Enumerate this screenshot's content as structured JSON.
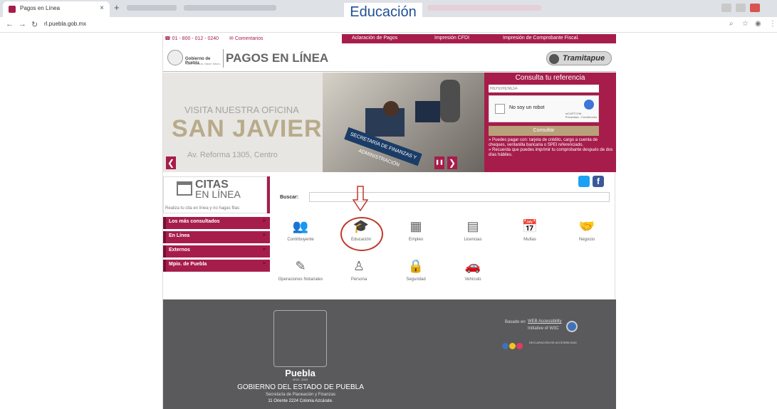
{
  "browser": {
    "tab_title": "Pagos en Línea",
    "tab_close": "×",
    "new_tab": "+",
    "url": "rl.puebla.gob.mx"
  },
  "overlay_title": "Educación",
  "site": {
    "topbar": {
      "phone": "01 - 800 - 012 - 0240",
      "comments": "Comentarios",
      "nav": [
        "Aclaración de Pagos",
        "Impresión CFDI",
        "Impresión de Comprobante Fiscal."
      ]
    },
    "logo_text": "Gobierno de Puebla",
    "logo_subtext": "Hacer historia. Hacer futuro.",
    "page_title": "PAGOS EN LÍNEA",
    "tramitapue": "Tramitapue",
    "banner": {
      "line1": "VISITA NUESTRA OFICINA",
      "line2": "SAN JAVIER",
      "line3": "Av. Reforma 1305, Centro",
      "sign": "SECRETARÍA DE FINANZAS Y ADMINISTRACIÓN",
      "prev": "❮",
      "pause": "❚❚",
      "next": "❯"
    },
    "consulta": {
      "title": "Consulta tu referencia",
      "placeholder": "REFERENCIA",
      "captcha_label": "No soy un robot",
      "captcha_brand": "reCAPTCHA",
      "captcha_terms": "Privacidad - Condiciones",
      "button": "Consultar",
      "info1": "» Puedes pagar con: tarjeta de crédito, cargo a cuenta de cheques, ventanilla bancaria o SPEI referenciado.",
      "info2": "» Recuerda que puedes imprimir tu comprobante después de dos días hábiles."
    },
    "citas": {
      "title1": "CITAS",
      "title2": "EN LÍNEA",
      "sub": "Realiza tu cita en línea y no hagas filas"
    },
    "menu": [
      {
        "label": "Los más consultados",
        "arrow": "►"
      },
      {
        "label": "En Línea",
        "arrow": "►"
      },
      {
        "label": "Externos",
        "arrow": "►"
      },
      {
        "label": "Mpio. de Puebla",
        "arrow": "►"
      }
    ],
    "search_label": "Buscar:",
    "categories": [
      {
        "label": "Contribuyente",
        "icon": "users-icon",
        "glyph": "👥"
      },
      {
        "label": "Educación",
        "icon": "graduation-cap-icon",
        "glyph": "🎓"
      },
      {
        "label": "Empleo",
        "icon": "building-icon",
        "glyph": "▦"
      },
      {
        "label": "Licencias",
        "icon": "id-card-icon",
        "glyph": "▤"
      },
      {
        "label": "Multas",
        "icon": "calendar-check-icon",
        "glyph": "📅"
      },
      {
        "label": "Negocio",
        "icon": "handshake-icon",
        "glyph": "🤝"
      },
      {
        "label": "Operaciones Notariales",
        "icon": "edit-icon",
        "glyph": "✎"
      },
      {
        "label": "Persona",
        "icon": "person-icon",
        "glyph": "♙"
      },
      {
        "label": "Seguridad",
        "icon": "lock-icon",
        "glyph": "🔒"
      },
      {
        "label": "Vehículo",
        "icon": "car-icon",
        "glyph": "🚗"
      }
    ],
    "footer": {
      "puebla": "Puebla",
      "years": "2018 - 2024",
      "gov": "GOBIERNO DEL ESTADO DE PUEBLA",
      "secretaria": "Secretaría de Planeación y Finanzas",
      "address": "11 Oriente 2224 Colonia Azcárate.",
      "wa_label": "Basado en",
      "wa_title": "WEB Accessibility",
      "wa_sub": "Initiative of W3C",
      "declaracion": "DECLARACIÓN DE ACCESIBILIDAD"
    }
  }
}
